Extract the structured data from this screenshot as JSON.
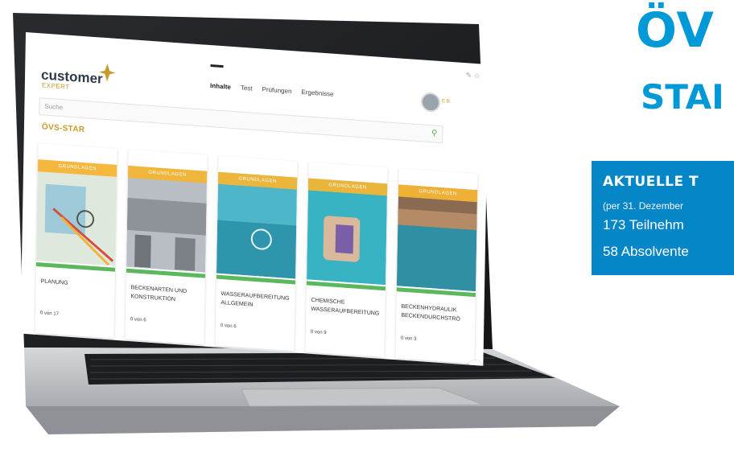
{
  "promo": {
    "title_big": "ÖV",
    "title_mid": "STAI",
    "box_heading": "AKTUELLE T",
    "box_date": "(per 31. Dezember",
    "box_line1": "173 Teilnehm",
    "box_line2": "58 Absolvente",
    "colors": {
      "accent": "#0099d8",
      "box": "#0587c7"
    }
  },
  "app": {
    "logo_text": "customer",
    "logo_sub": "EXPERT",
    "nav": [
      "Inhalte",
      "Test",
      "Prüfungen",
      "Ergebnisse"
    ],
    "avatar_label": "E.B.",
    "search_placeholder": "Suche",
    "section_title": "ÖVS-STAR",
    "cards": [
      {
        "tag": "GRUNDLAGEN",
        "title": "PLANUNG",
        "count": "0 von 17"
      },
      {
        "tag": "GRUNDLAGEN",
        "title": "BECKENARTEN UND KONSTRUKTION",
        "count": "0 von 6"
      },
      {
        "tag": "GRUNDLAGEN",
        "title": "WASSERAUFBEREITUNG ALLGEMEIN",
        "count": "0 von 6"
      },
      {
        "tag": "GRUNDLAGEN",
        "title": "CHEMISCHE WASSERAUFBEREITUNG",
        "count": "0 von 9"
      },
      {
        "tag": "GRUNDLAGEN",
        "title": "BECKENHYDRAULIK BECKENDURCHSTRÖ",
        "count": "0 von 3"
      }
    ],
    "icons": {
      "search": "search-icon",
      "next": "chevron-right-icon",
      "pin": "pin-icon",
      "star": "star-icon"
    },
    "colors": {
      "tag": "#f4b634",
      "progress": "#5cb85c",
      "gold": "#c89a2b"
    }
  }
}
